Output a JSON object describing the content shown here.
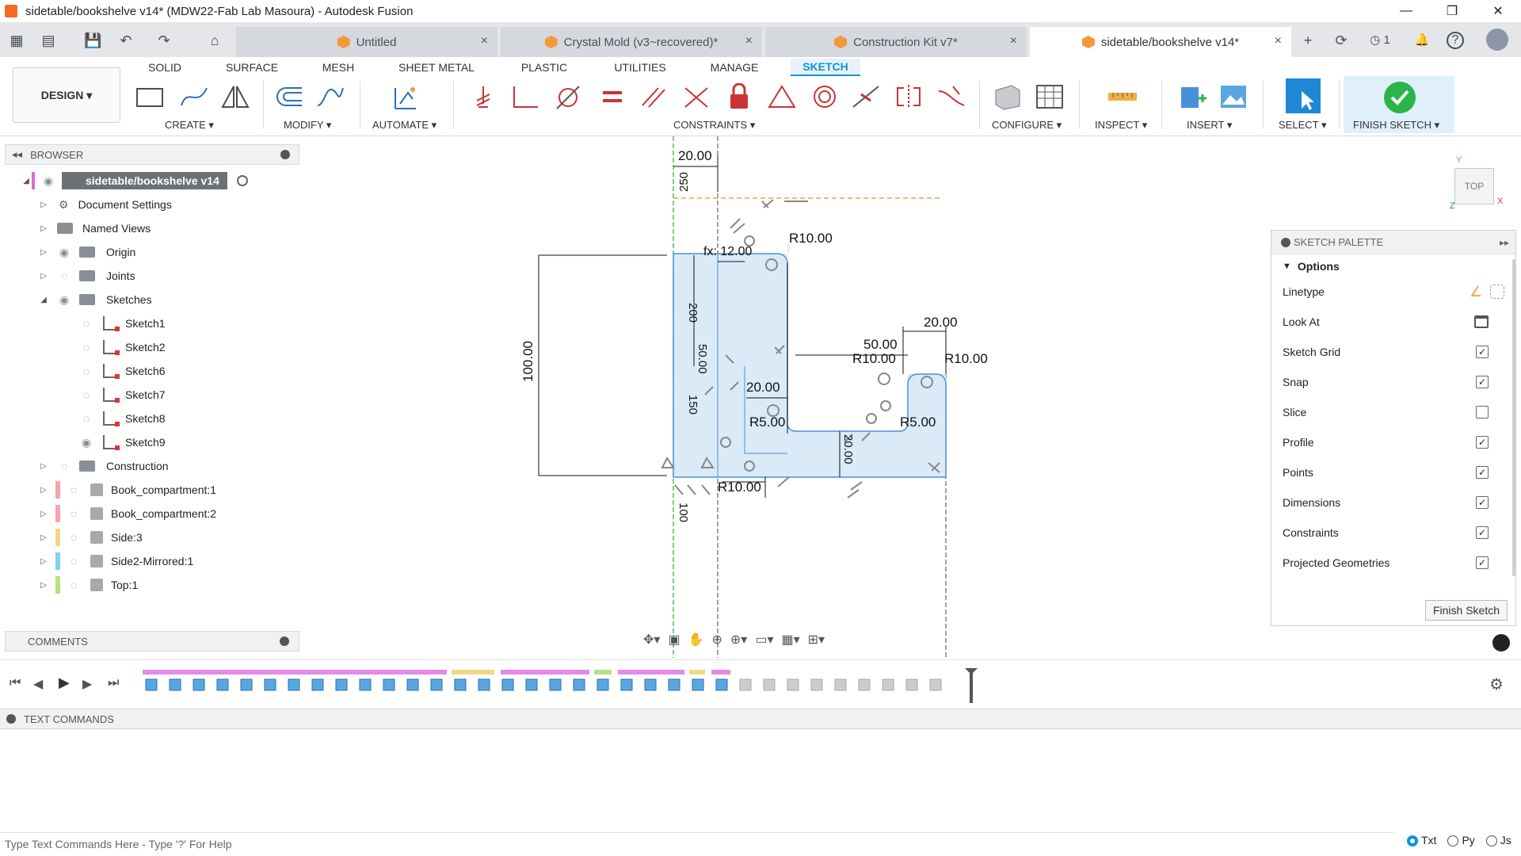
{
  "window": {
    "title": "sidetable/bookshelve v14* (MDW22-Fab Lab Masoura) - Autodesk Fusion",
    "minimize": "—",
    "maximize": "❐",
    "close": "✕"
  },
  "doc_tabs": [
    {
      "label": "Untitled"
    },
    {
      "label": "Crystal Mold (v3~recovered)*"
    },
    {
      "label": "Construction Kit v7*"
    },
    {
      "label": "sidetable/bookshelve v14*"
    }
  ],
  "tab_close": "×",
  "tabbar_icons": {
    "add": "+",
    "sync": "⟳",
    "jobs": "◷ 1",
    "notify": "🔔",
    "help": "?"
  },
  "ribbon": {
    "design_label": "DESIGN ▾",
    "tabs": [
      "SOLID",
      "SURFACE",
      "MESH",
      "SHEET METAL",
      "PLASTIC",
      "UTILITIES",
      "MANAGE",
      "SKETCH"
    ],
    "groups": {
      "create": "CREATE ▾",
      "modify": "MODIFY ▾",
      "automate": "AUTOMATE ▾",
      "constraints": "CONSTRAINTS ▾",
      "configure": "CONFIGURE ▾",
      "inspect": "INSPECT ▾",
      "insert": "INSERT ▾",
      "select": "SELECT ▾",
      "finish": "FINISH SKETCH ▾"
    }
  },
  "browser": {
    "title": "BROWSER",
    "root": "sidetable/bookshelve v14",
    "items": [
      {
        "label": "Document Settings"
      },
      {
        "label": "Named Views"
      },
      {
        "label": "Origin"
      },
      {
        "label": "Joints"
      },
      {
        "label": "Sketches"
      },
      {
        "label": "Sketch1"
      },
      {
        "label": "Sketch2"
      },
      {
        "label": "Sketch6"
      },
      {
        "label": "Sketch7"
      },
      {
        "label": "Sketch8"
      },
      {
        "label": "Sketch9"
      },
      {
        "label": "Construction"
      },
      {
        "label": "Book_compartment:1"
      },
      {
        "label": "Book_compartment:2"
      },
      {
        "label": "Side:3"
      },
      {
        "label": "Side2-Mirrored:1"
      },
      {
        "label": "Top:1"
      }
    ]
  },
  "comments": {
    "title": "COMMENTS"
  },
  "sketch": {
    "dims": {
      "top_width": "20.00",
      "top_vert": "250",
      "r_top": "R10.00",
      "fx": "fx: 12.00",
      "vert_200": "200",
      "vert_50": "50.00",
      "left_100": "100.00",
      "vert_150": "150",
      "mid_20": "20.00",
      "r5_left": "R5.00",
      "right_20": "20.00",
      "right_50": "50.00",
      "r10_mid": "R10.00",
      "r10_right": "R10.00",
      "r5_right": "R5.00",
      "vert_20": "20.00",
      "r10_bottom": "R10.00",
      "vert_100": "100"
    }
  },
  "viewcube": {
    "label": "TOP",
    "axis_y": "Y",
    "axis_x": "X",
    "axis_z": "Z"
  },
  "palette": {
    "title": "SKETCH PALETTE",
    "section": "Options",
    "rows": [
      {
        "label": "Linetype",
        "checked": null
      },
      {
        "label": "Look At",
        "checked": null
      },
      {
        "label": "Sketch Grid",
        "checked": true
      },
      {
        "label": "Snap",
        "checked": true
      },
      {
        "label": "Slice",
        "checked": false
      },
      {
        "label": "Profile",
        "checked": true
      },
      {
        "label": "Points",
        "checked": true
      },
      {
        "label": "Dimensions",
        "checked": true
      },
      {
        "label": "Constraints",
        "checked": true
      },
      {
        "label": "Projected Geometries",
        "checked": true
      }
    ],
    "finish_button": "Finish Sketch"
  },
  "text_commands": {
    "title": "TEXT COMMANDS",
    "placeholder": "Type Text Commands Here - Type '?' For Help",
    "modes": [
      "Txt",
      "Py",
      "Js"
    ]
  },
  "colors": {
    "accent": "#0696d7",
    "sketch_fill": "#dbeaf7",
    "finish_green": "#2bb44a"
  }
}
